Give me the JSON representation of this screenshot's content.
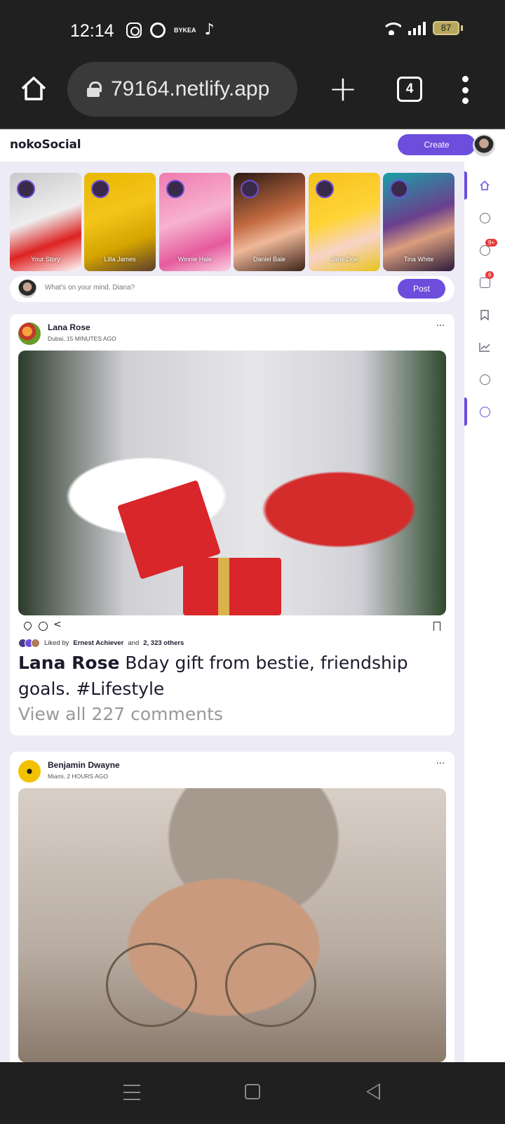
{
  "status_bar": {
    "time": "12:14",
    "app_icons": [
      "instagram-icon",
      "timer-icon",
      "bykea-icon",
      "tiktok-icon"
    ],
    "bykea_label": "BYKEA",
    "battery": "87"
  },
  "browser": {
    "url": "79164.netlify.app",
    "tab_count": "4"
  },
  "app": {
    "logo": "nokoSocial",
    "create_label": "Create"
  },
  "stories": [
    {
      "name": "Your Story"
    },
    {
      "name": "Lilla James"
    },
    {
      "name": "Winnie Hale"
    },
    {
      "name": "Daniel Bale"
    },
    {
      "name": "Jane Doe"
    },
    {
      "name": "Tina White"
    }
  ],
  "composer": {
    "placeholder": "What's on your mind, Diana?",
    "post_label": "Post"
  },
  "sidebar": {
    "items": [
      {
        "icon": "home-icon",
        "active": true
      },
      {
        "icon": "explore-icon"
      },
      {
        "icon": "notifications-icon",
        "badge": "9+"
      },
      {
        "icon": "messages-icon",
        "badge": "6"
      },
      {
        "icon": "bookmarks-icon"
      },
      {
        "icon": "analytics-icon"
      },
      {
        "icon": "theme-icon"
      },
      {
        "icon": "settings-icon",
        "active": true
      }
    ]
  },
  "feed": [
    {
      "author": "Lana Rose",
      "meta": "Dubai, 15 MINUTES AGO",
      "more": "···",
      "liked_by_prefix": "Liked by",
      "liked_by_name": "Ernest Achiever",
      "liked_by_and": "and",
      "liked_by_count": "2, 323 others",
      "caption_author": "Lana Rose",
      "caption_text": "Bday gift from bestie, friendship goals. #Lifestyle",
      "comments": "View all 227 comments"
    },
    {
      "author": "Benjamin Dwayne",
      "meta": "Miami, 2 HOURS AGO",
      "more": "···"
    }
  ],
  "colors": {
    "accent": "#6c4ddc",
    "page_bg": "#ecebf6",
    "badge": "#e83b3b"
  }
}
